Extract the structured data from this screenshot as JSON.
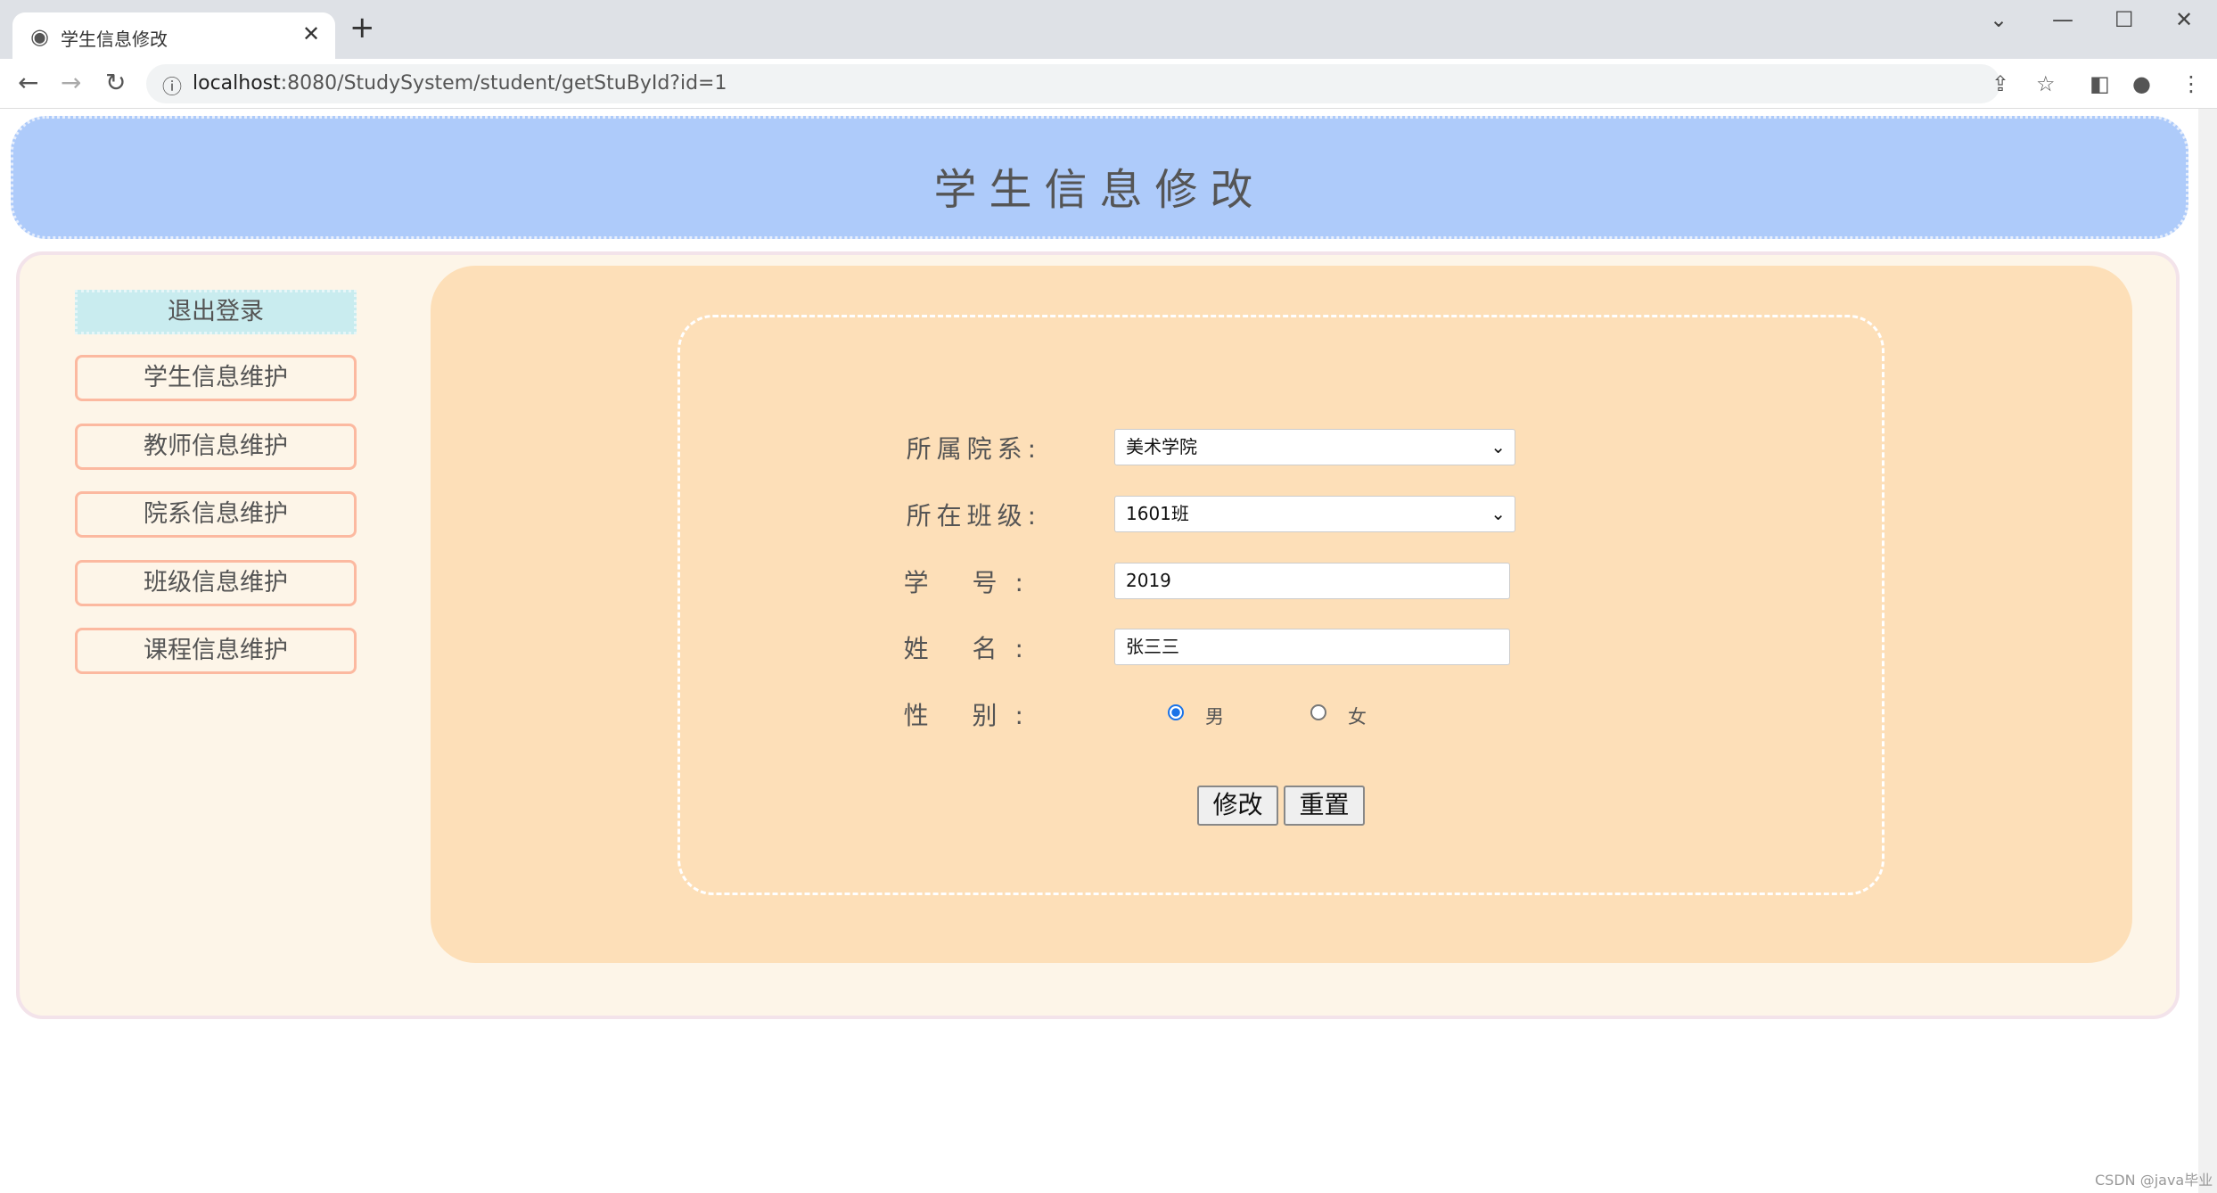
{
  "browser": {
    "tab_title": "学生信息修改",
    "url_host": "localhost",
    "url_rest": ":8080/StudySystem/student/getStuById?id=1"
  },
  "header": {
    "title": "学生信息修改"
  },
  "sidebar": {
    "logout": "退出登录",
    "items": [
      {
        "label": "学生信息维护"
      },
      {
        "label": "教师信息维护"
      },
      {
        "label": "院系信息维护"
      },
      {
        "label": "班级信息维护"
      },
      {
        "label": "课程信息维护"
      }
    ]
  },
  "form": {
    "department_label": "所属院系:",
    "department_value": "美术学院",
    "class_label": "所在班级:",
    "class_value": "1601班",
    "student_id_label": "学 号:",
    "student_id_value": "2019",
    "name_label": "姓 名:",
    "name_value": "张三三",
    "gender_label": "性 别:",
    "gender_options": [
      "男",
      "女"
    ],
    "gender_selected": "男",
    "submit_label": "修改",
    "reset_label": "重置"
  },
  "watermark": "CSDN @java毕业",
  "colors": {
    "header": "#aecbfa",
    "panel": "#fdf5e8",
    "main": "#fddfb8",
    "logout": "#c9ecef",
    "nav_border": "#fcb9a0"
  }
}
